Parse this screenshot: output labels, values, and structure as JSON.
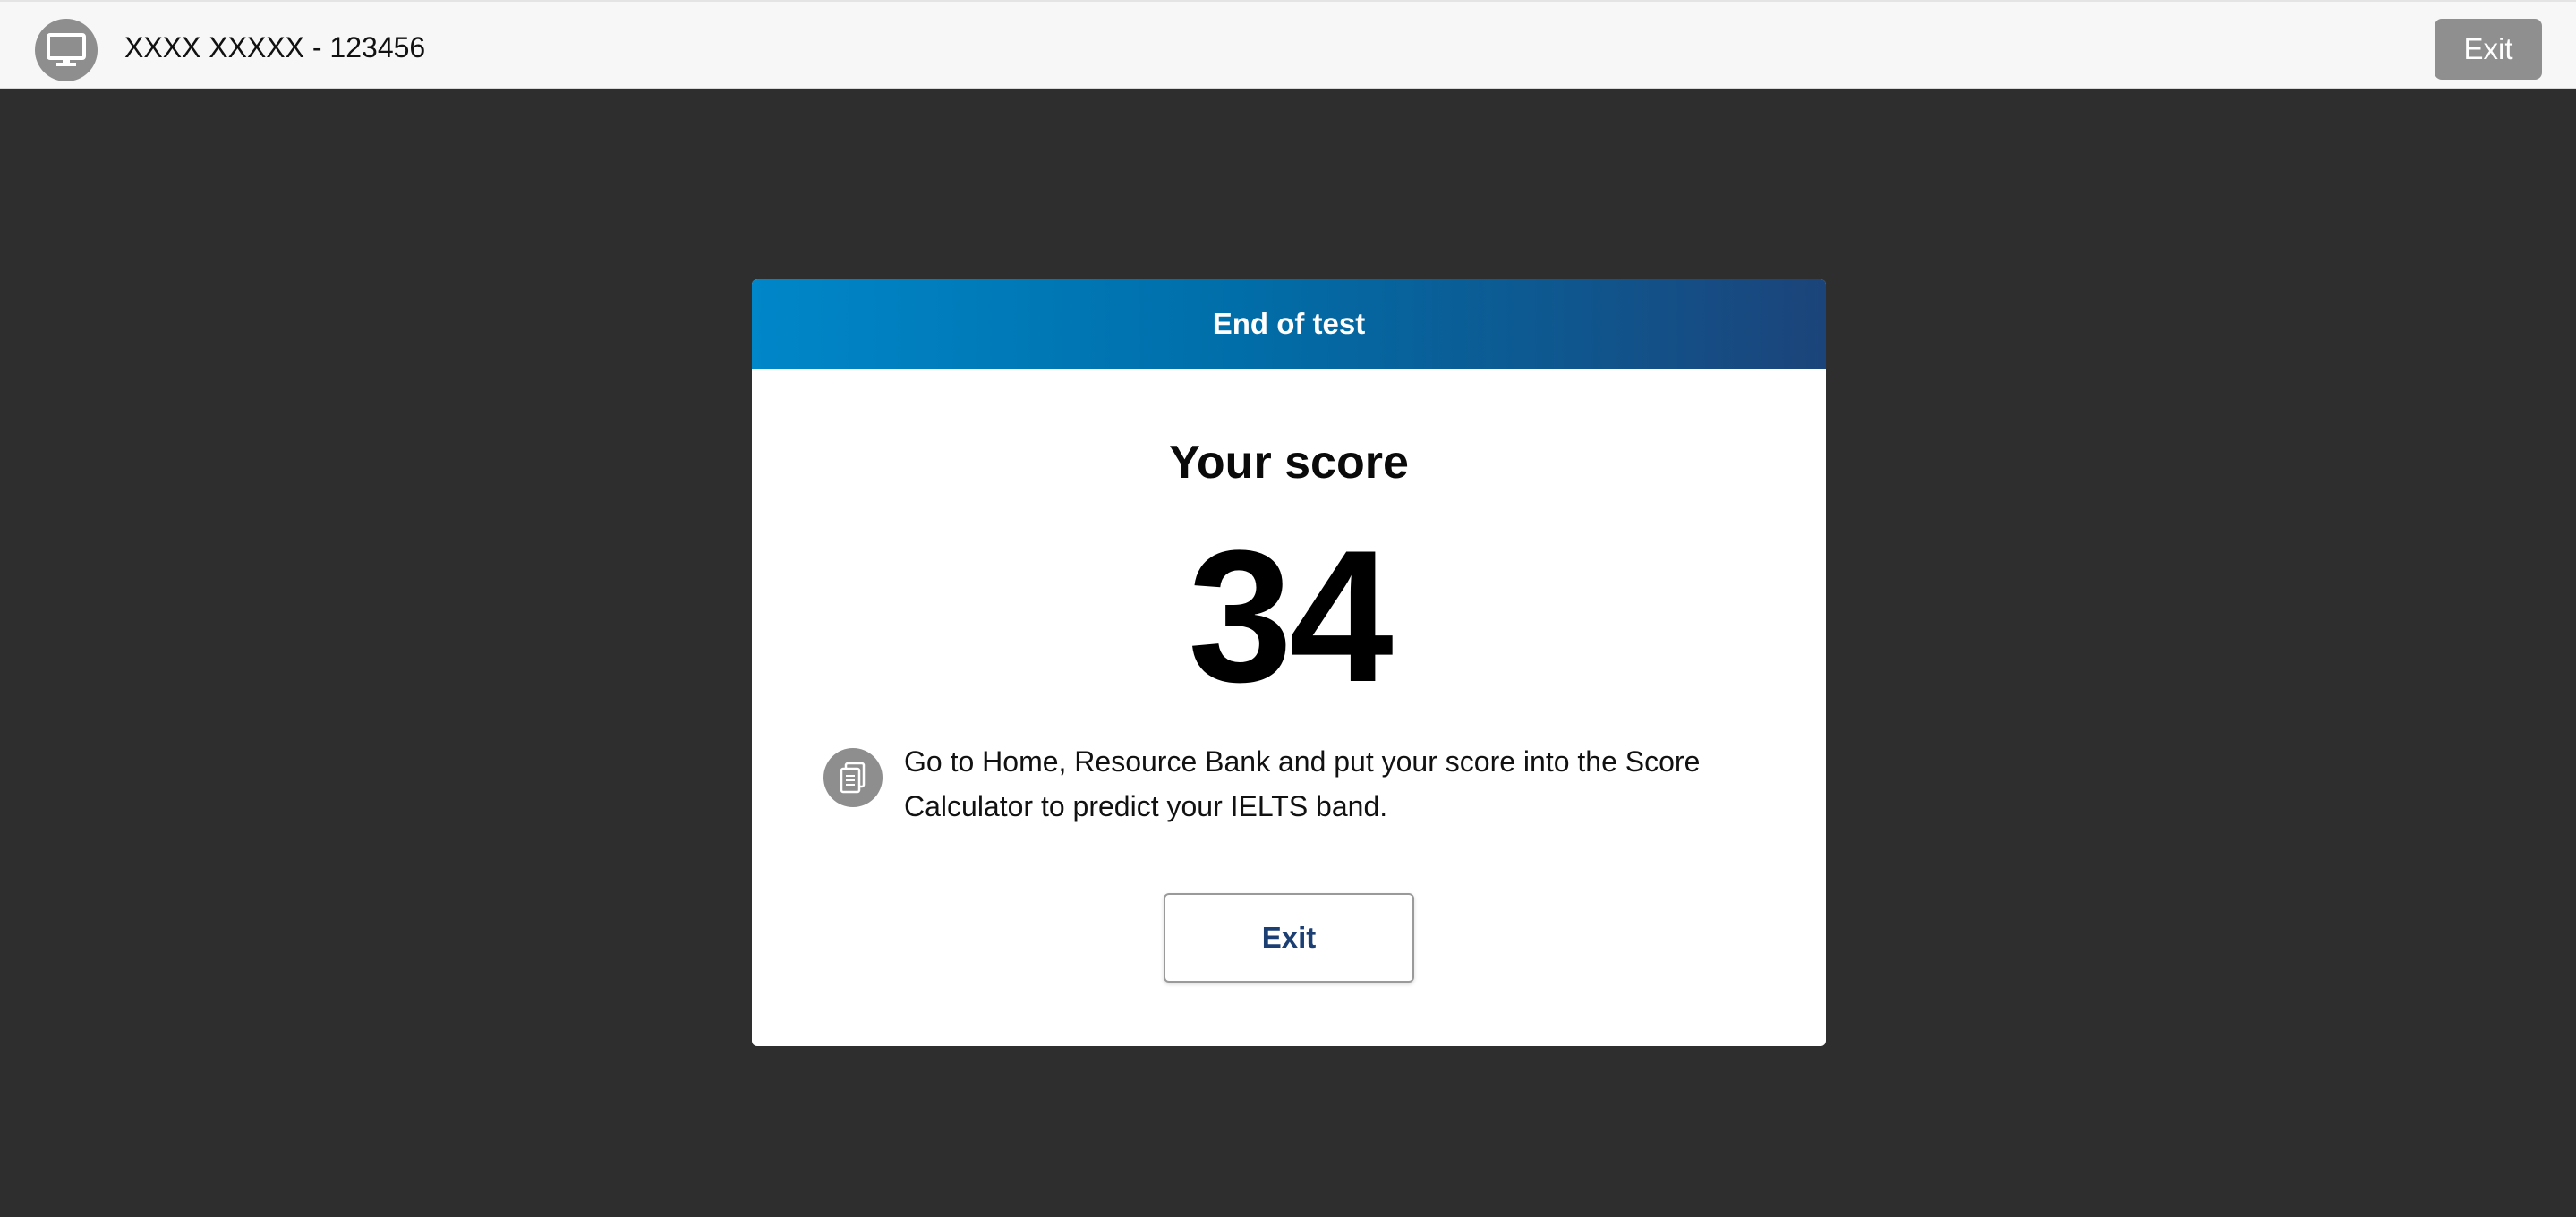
{
  "header": {
    "candidate_label": "XXXX XXXXX - 123456",
    "exit_label": "Exit",
    "icon": "monitor-icon"
  },
  "card": {
    "title": "End of test",
    "score_label": "Your score",
    "score_value": "34",
    "info_icon": "document-icon",
    "info_text": "Go to Home, Resource Bank and put your score into the Score Calculator to predict your IELTS band.",
    "exit_label": "Exit"
  },
  "colors": {
    "background": "#2e2e2e",
    "topbar": "#f7f7f7",
    "header_gradient_start": "#0087c9",
    "header_gradient_end": "#1b447a",
    "exit_text": "#1b3f73",
    "icon_badge": "#8e8e8e"
  }
}
